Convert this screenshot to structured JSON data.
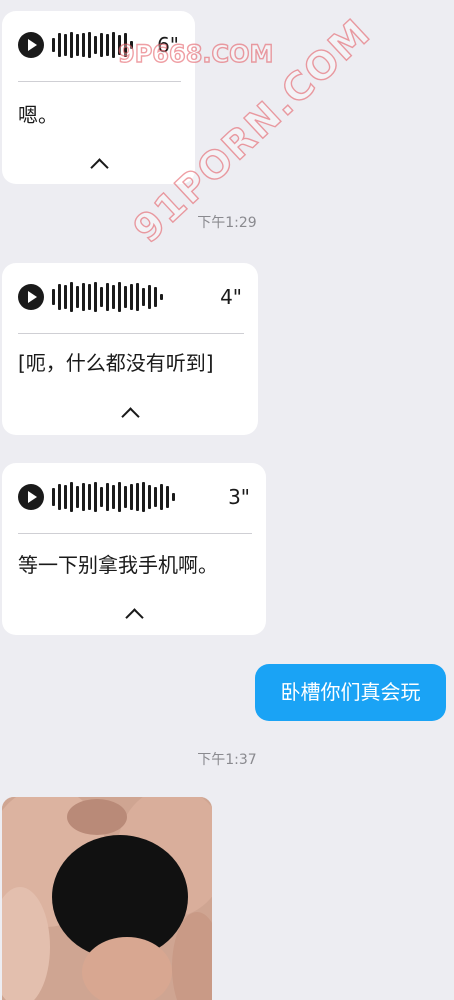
{
  "messages": [
    {
      "type": "voice",
      "duration": "6\"",
      "transcript": "嗯。"
    },
    {
      "type": "timestamp",
      "text": "下午1:29"
    },
    {
      "type": "voice",
      "duration": "4\"",
      "transcript": "[呃，什么都没有听到]"
    },
    {
      "type": "voice",
      "duration": "3\"",
      "transcript": "等一下别拿我手机啊。"
    },
    {
      "type": "text_sent",
      "text": "卧槽你们真会玩"
    },
    {
      "type": "timestamp",
      "text": "下午1:37"
    },
    {
      "type": "image_received"
    }
  ],
  "watermarks": [
    "9P668.COM",
    "91PORN.COM"
  ],
  "colors": {
    "background": "#ededf2",
    "received_bubble": "#ffffff",
    "sent_bubble": "#1aa3f5",
    "timestamp_text": "#8a8a8f",
    "watermark_stroke": "#e1505a"
  },
  "icons": {
    "play": "play-icon",
    "collapse": "chevron-up-icon"
  }
}
